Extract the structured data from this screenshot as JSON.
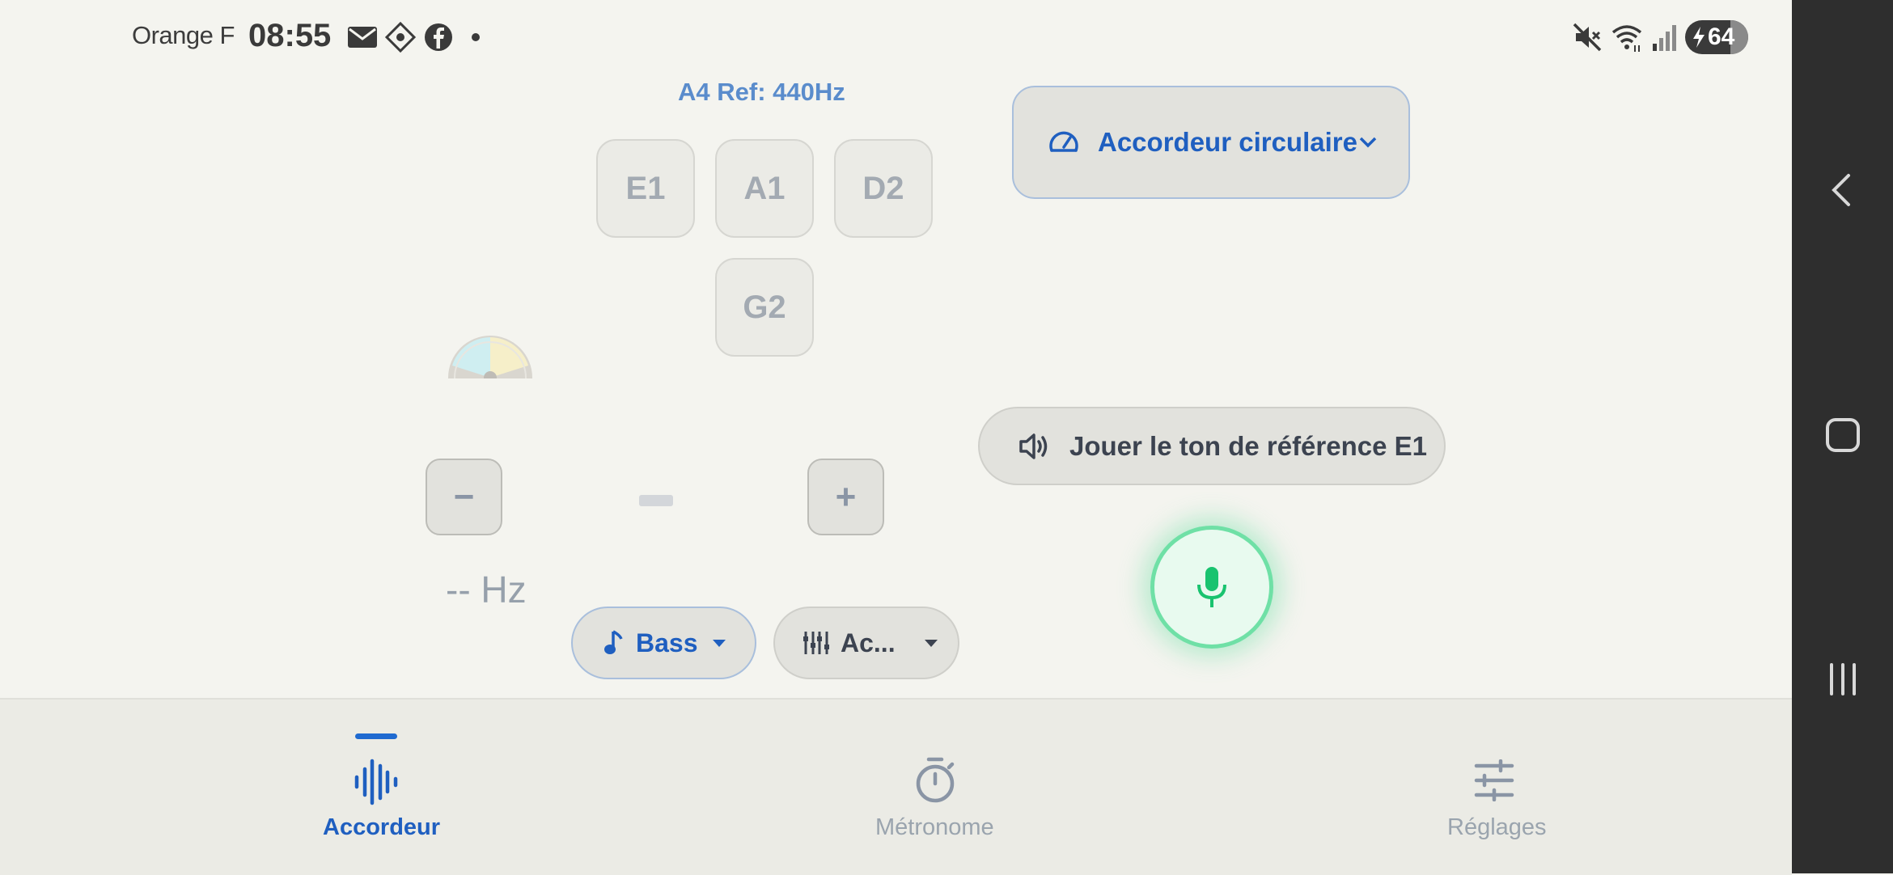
{
  "status_bar": {
    "carrier": "Orange F",
    "time": "08:55",
    "battery": "64",
    "left_icons": [
      "mail-icon",
      "messenger-diamond-icon",
      "facebook-icon",
      "dot-icon"
    ],
    "right_icons": [
      "mute-icon",
      "wifi-icon",
      "signal-icon",
      "battery-icon"
    ]
  },
  "tuner": {
    "reference": "A4 Ref: 440Hz",
    "strings": [
      "E1",
      "A1",
      "D2",
      "G2"
    ],
    "mode_select": {
      "label": "Accordeur circulaire",
      "icon": "speedometer-icon"
    },
    "reference_tone": {
      "label": "Jouer le ton de référence E1",
      "icon": "speaker-icon"
    },
    "minus_label": "−",
    "plus_label": "+",
    "frequency": "-- Hz",
    "instrument": {
      "label": "Bass",
      "icon": "music-note-icon"
    },
    "tuning": {
      "label": "Ac...",
      "icon": "tuning-pegs-icon"
    },
    "mic_active": true
  },
  "bottom_nav": {
    "tabs": [
      {
        "label": "Accordeur",
        "icon": "waveform-icon",
        "active": true
      },
      {
        "label": "Métronome",
        "icon": "stopwatch-icon",
        "active": false
      },
      {
        "label": "Réglages",
        "icon": "sliders-icon",
        "active": false
      }
    ]
  },
  "colors": {
    "background": "#f4f4ef",
    "accent": "#1f5fc0",
    "mic_green": "#19c36f",
    "system_nav": "#2e2e2e"
  }
}
